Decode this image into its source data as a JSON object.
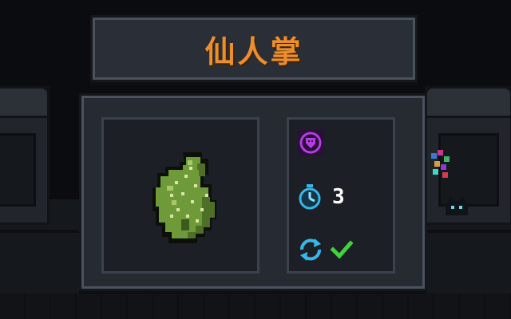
{
  "item": {
    "name": "仙人掌",
    "icon": "cactus-sprite"
  },
  "stats": {
    "buff_icon": "shield-buff-icon",
    "cooldown_icon": "stopwatch-icon",
    "cooldown_value": "3",
    "recharge_icon": "cycle-arrows-icon",
    "recharge_status_icon": "green-check-icon"
  },
  "colors": {
    "title_text": "#ec8e2c",
    "panel_bg": "#262a31",
    "panel_border": "#4a525e",
    "buff_purple": "#b43de0",
    "cooldown_cyan": "#38b6e8",
    "check_green": "#3fd43a",
    "cactus_green": "#6f9a3a"
  }
}
